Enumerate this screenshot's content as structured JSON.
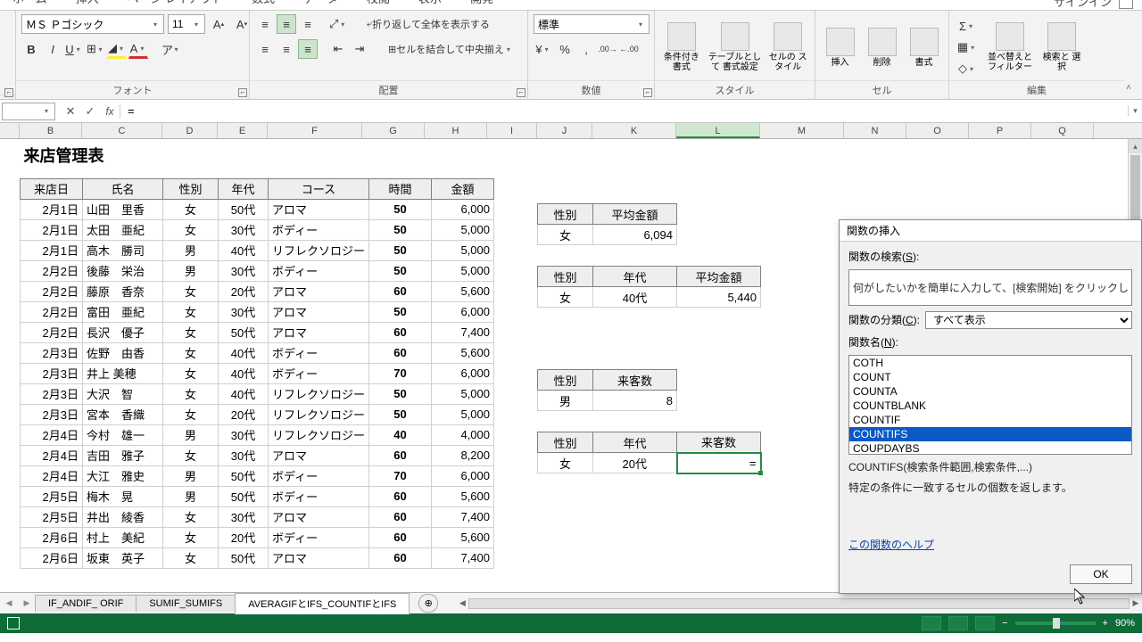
{
  "menu": {
    "tabs": [
      "ホーム",
      "挿入",
      "ページ レイアウト",
      "数式",
      "データ",
      "校閲",
      "表示",
      "開発"
    ],
    "right": "サインイン"
  },
  "ribbon": {
    "font": {
      "name": "ＭＳ Ｐゴシック",
      "size": "11",
      "label": "フォント"
    },
    "align": {
      "wrap": "折り返して全体を表示する",
      "merge": "セルを結合して中央揃え",
      "label": "配置"
    },
    "number": {
      "fmt": "標準",
      "label": "数値"
    },
    "styles": {
      "cf": "条件付き\n書式",
      "tbl": "テーブルとして\n書式設定",
      "cell": "セルの\nスタイル",
      "label": "スタイル"
    },
    "cells": {
      "ins": "挿入",
      "del": "削除",
      "fmt": "書式",
      "label": "セル"
    },
    "edit": {
      "sort": "並べ替えと\nフィルター",
      "find": "検索と\n選択",
      "label": "編集"
    }
  },
  "formula": {
    "value": "="
  },
  "columns": [
    "B",
    "C",
    "D",
    "E",
    "F",
    "G",
    "H",
    "I",
    "J",
    "K",
    "L",
    "M",
    "N",
    "O",
    "P",
    "Q"
  ],
  "title": "来店管理表",
  "thead": [
    "来店日",
    "氏名",
    "性別",
    "年代",
    "コース",
    "時間",
    "金額"
  ],
  "rows": [
    [
      "2月1日",
      "山田　里香",
      "女",
      "50代",
      "アロマ",
      "50",
      "6,000"
    ],
    [
      "2月1日",
      "太田　亜紀",
      "女",
      "30代",
      "ボディー",
      "50",
      "5,000"
    ],
    [
      "2月1日",
      "高木　勝司",
      "男",
      "40代",
      "リフレクソロジー",
      "50",
      "5,000"
    ],
    [
      "2月2日",
      "後藤　栄治",
      "男",
      "30代",
      "ボディー",
      "50",
      "5,000"
    ],
    [
      "2月2日",
      "藤原　香奈",
      "女",
      "20代",
      "アロマ",
      "60",
      "5,600"
    ],
    [
      "2月2日",
      "富田　亜紀",
      "女",
      "30代",
      "アロマ",
      "50",
      "6,000"
    ],
    [
      "2月2日",
      "長沢　優子",
      "女",
      "50代",
      "アロマ",
      "60",
      "7,400"
    ],
    [
      "2月3日",
      "佐野　由香",
      "女",
      "40代",
      "ボディー",
      "60",
      "5,600"
    ],
    [
      "2月3日",
      "井上 美穂",
      "女",
      "40代",
      "ボディー",
      "70",
      "6,000"
    ],
    [
      "2月3日",
      "大沢　智",
      "女",
      "40代",
      "リフレクソロジー",
      "50",
      "5,000"
    ],
    [
      "2月3日",
      "宮本　香織",
      "女",
      "20代",
      "リフレクソロジー",
      "50",
      "5,000"
    ],
    [
      "2月4日",
      "今村　雄一",
      "男",
      "30代",
      "リフレクソロジー",
      "40",
      "4,000"
    ],
    [
      "2月4日",
      "吉田　雅子",
      "女",
      "30代",
      "アロマ",
      "60",
      "8,200"
    ],
    [
      "2月4日",
      "大江　雅史",
      "男",
      "50代",
      "ボディー",
      "70",
      "6,000"
    ],
    [
      "2月5日",
      "梅木　晃",
      "男",
      "50代",
      "ボディー",
      "60",
      "5,600"
    ],
    [
      "2月5日",
      "井出　綾香",
      "女",
      "30代",
      "アロマ",
      "60",
      "7,400"
    ],
    [
      "2月6日",
      "村上　美紀",
      "女",
      "20代",
      "ボディー",
      "60",
      "5,600"
    ],
    [
      "2月6日",
      "坂東　英子",
      "女",
      "50代",
      "アロマ",
      "60",
      "7,400"
    ]
  ],
  "side": {
    "t1": {
      "h": [
        "性別",
        "平均金額"
      ],
      "r": [
        "女",
        "6,094"
      ]
    },
    "t2": {
      "h": [
        "性別",
        "年代",
        "平均金額"
      ],
      "r": [
        "女",
        "40代",
        "5,440"
      ]
    },
    "t3": {
      "h": [
        "性別",
        "来客数"
      ],
      "r": [
        "男",
        "8"
      ]
    },
    "t4": {
      "h": [
        "性別",
        "年代",
        "来客数"
      ],
      "r": [
        "女",
        "20代",
        "="
      ]
    }
  },
  "sheets": {
    "tabs": [
      "IF_ANDIF_ ORIF",
      "SUMIF_SUMIFS",
      "AVERAGIFとIFS_COUNTIFとIFS"
    ],
    "active": 2
  },
  "dialog": {
    "title": "関数の挿入",
    "search_label": "関数の検索(S):",
    "search_hint": "何がしたいかを簡単に入力して、[検索開始] をクリックしてください",
    "cat_label": "関数の分類(C):",
    "cat_value": "すべて表示",
    "name_label": "関数名(N):",
    "funcs": [
      "COTH",
      "COUNT",
      "COUNTA",
      "COUNTBLANK",
      "COUNTIF",
      "COUNTIFS",
      "COUPDAYBS"
    ],
    "selected": "COUNTIFS",
    "syntax": "COUNTIFS(検索条件範囲,検索条件,...)",
    "desc": "特定の条件に一致するセルの個数を返します。",
    "help": "この関数のヘルプ",
    "ok": "OK"
  },
  "status": {
    "zoom": "90%"
  }
}
